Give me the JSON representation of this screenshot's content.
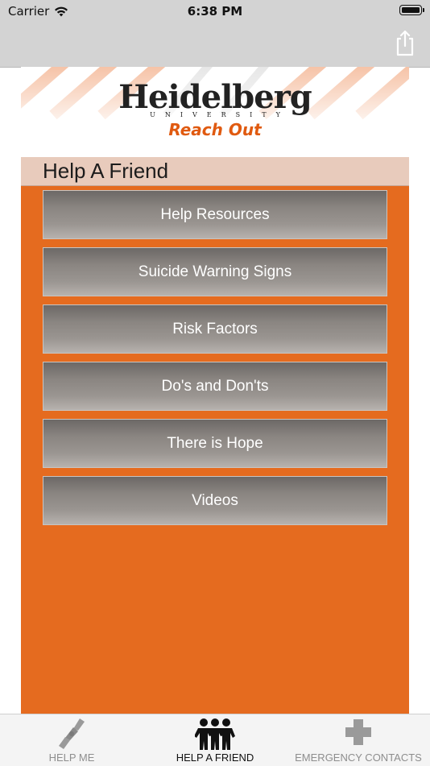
{
  "status_bar": {
    "carrier": "Carrier",
    "time": "6:38 PM",
    "icons": [
      "wifi-icon",
      "battery-icon"
    ]
  },
  "nav_bar": {
    "action_icon": "share-icon"
  },
  "banner": {
    "logo_word": "Heidelberg",
    "logo_sub": "UNIVERSITY",
    "logo_tagline": "Reach Out",
    "colors": {
      "tagline": "#e05a10",
      "stripes": "#f3b08a"
    }
  },
  "section": {
    "title": "Help A Friend"
  },
  "menu": {
    "items": [
      {
        "label": "Help Resources"
      },
      {
        "label": "Suicide Warning Signs"
      },
      {
        "label": "Risk Factors"
      },
      {
        "label": "Do's and Don'ts"
      },
      {
        "label": "There is Hope"
      },
      {
        "label": "Videos"
      }
    ]
  },
  "tab_bar": {
    "tabs": [
      {
        "label": "HELP ME",
        "icon": "helping-hands-icon",
        "active": false
      },
      {
        "label": "HELP A FRIEND",
        "icon": "friends-icon",
        "active": true
      },
      {
        "label": "EMERGENCY CONTACTS",
        "icon": "cross-icon",
        "active": false
      }
    ]
  },
  "colors": {
    "accent": "#e56b1f",
    "header_band": "#e8cbbc",
    "button_gray": "#8a8581"
  }
}
